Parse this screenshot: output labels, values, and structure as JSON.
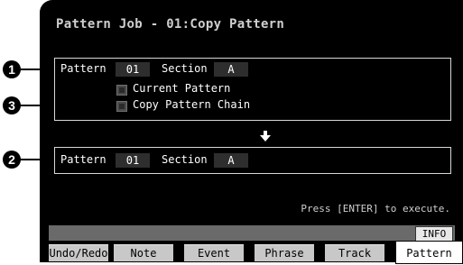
{
  "callouts": [
    "1",
    "2",
    "3"
  ],
  "title": "Pattern Job - 01:Copy Pattern",
  "source": {
    "pattern_label": "Pattern",
    "pattern_value": "01",
    "section_label": "Section",
    "section_value": "A",
    "options": [
      "Current Pattern",
      "Copy Pattern Chain"
    ]
  },
  "destination": {
    "pattern_label": "Pattern",
    "pattern_value": "01",
    "section_label": "Section",
    "section_value": "A"
  },
  "status_text": "Press [ENTER] to execute.",
  "info_button": "INFO",
  "tabs": [
    "Undo/Redo",
    "Note",
    "Event",
    "Phrase",
    "Track",
    "Pattern"
  ],
  "active_tab": "Pattern"
}
